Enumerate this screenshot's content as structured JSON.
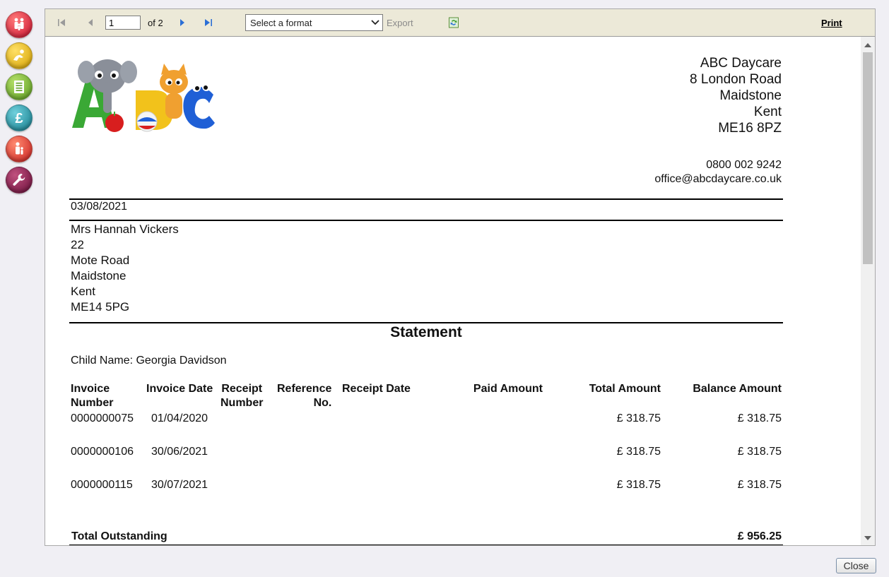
{
  "nav": {
    "items": [
      {
        "icon": "family-icon",
        "color": "#d9263a"
      },
      {
        "icon": "child-play-icon",
        "color": "#e6b800"
      },
      {
        "icon": "register-list-icon",
        "color": "#7ab530"
      },
      {
        "icon": "pound-icon",
        "color": "#1e8fa0"
      },
      {
        "icon": "staff-icon",
        "color": "#e03a2e"
      },
      {
        "icon": "wrench-icon",
        "color": "#8c1a4e"
      }
    ]
  },
  "toolbar": {
    "page_value": "1",
    "of_pages": "of 2",
    "format_placeholder": "Select a format",
    "export_label": "Export",
    "print_label": "Print"
  },
  "company": {
    "name": "ABC Daycare",
    "address_line1": "8 London Road",
    "town": "Maidstone",
    "county": "Kent",
    "postcode": "ME16 8PZ",
    "phone": "0800 002 9242",
    "email": "office@abcdaycare.co.uk"
  },
  "statement_date": "03/08/2021",
  "recipient": {
    "name": "Mrs Hannah Vickers",
    "house": "22",
    "street": "Mote Road",
    "town": "Maidstone",
    "county": "Kent",
    "postcode": "ME14 5PG"
  },
  "statement": {
    "title": "Statement",
    "child_name": "Child Name: Georgia Davidson",
    "headers": {
      "invoice_number": [
        "Invoice",
        "Number"
      ],
      "invoice_date": "Invoice Date",
      "receipt_number": [
        "Receipt",
        "Number"
      ],
      "reference_no": [
        "Reference",
        "No."
      ],
      "receipt_date": "Receipt Date",
      "paid_amount": "Paid Amount",
      "total_amount": "Total Amount",
      "balance_amount": "Balance Amount"
    },
    "rows": [
      {
        "invoice_number": "0000000075",
        "invoice_date": "01/04/2020",
        "total_amount": "£ 318.75",
        "balance_amount": "£ 318.75"
      },
      {
        "invoice_number": "0000000106",
        "invoice_date": "30/06/2021",
        "total_amount": "£ 318.75",
        "balance_amount": "£ 318.75"
      },
      {
        "invoice_number": "0000000115",
        "invoice_date": "30/07/2021",
        "total_amount": "£ 318.75",
        "balance_amount": "£ 318.75"
      }
    ],
    "total_label": "Total Outstanding",
    "total_value": "£ 956.25"
  },
  "close_label": "Close"
}
